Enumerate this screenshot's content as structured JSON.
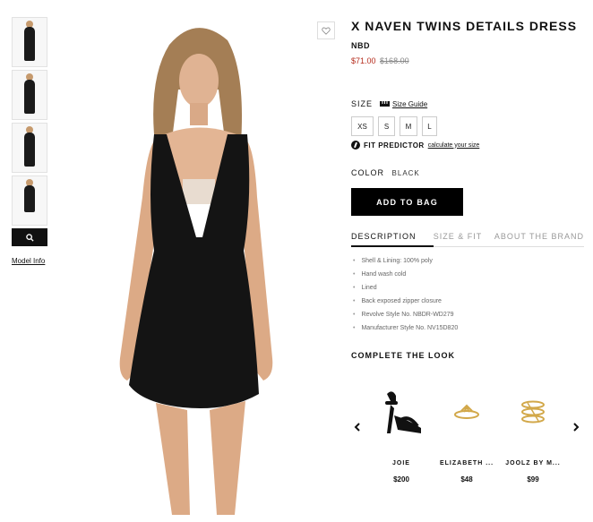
{
  "product": {
    "title": "X NAVEN TWINS DETAILS DRESS",
    "brand": "NBD",
    "price_sale": "$71.00",
    "price_original": "$168.00"
  },
  "size": {
    "label": "SIZE",
    "guide_label": "Size Guide",
    "options": [
      "XS",
      "S",
      "M",
      "L"
    ]
  },
  "fit_predictor": {
    "label": "FIT PREDICTOR",
    "link": "calculate your size"
  },
  "color": {
    "label": "COLOR",
    "value": "BLACK"
  },
  "add_to_bag_label": "ADD TO BAG",
  "tabs": [
    "DESCRIPTION",
    "SIZE & FIT",
    "ABOUT THE BRAND"
  ],
  "details": [
    "Shell & Lining: 100% poly",
    "Hand wash cold",
    "Lined",
    "Back exposed zipper closure",
    "Revolve Style No. NBDR-WD279",
    "Manufacturer Style No. NV15D820"
  ],
  "complete_the_look": {
    "title": "COMPLETE THE LOOK",
    "items": [
      {
        "name": "JOIE",
        "price": "$200",
        "icon": "sandal-icon"
      },
      {
        "name": "ELIZABETH ...",
        "price": "$48",
        "icon": "ring-icon"
      },
      {
        "name": "JOOLZ BY M...",
        "price": "$99",
        "icon": "stacked-ring-icon"
      }
    ]
  },
  "model_info_label": "Model Info",
  "colors": {
    "sale_red": "#b52b1c",
    "primary_black": "#000000"
  }
}
